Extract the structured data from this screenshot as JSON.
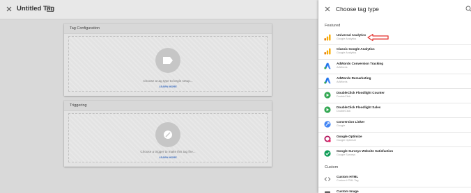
{
  "editor": {
    "title": "Untitled Tag",
    "tag_card": {
      "header": "Tag Configuration",
      "prompt": "Choose a tag type to begin setup...",
      "learn_more": "LEARN MORE"
    },
    "trigger_card": {
      "header": "Triggering",
      "prompt": "Choose a trigger to make this tag fire...",
      "learn_more": "LEARN MORE"
    }
  },
  "panel": {
    "title": "Choose tag type",
    "featured_label": "Featured",
    "custom_label": "Custom",
    "featured": [
      {
        "name": "Universal Analytics",
        "sub": "Google Analytics",
        "icon": "google-analytics-icon"
      },
      {
        "name": "Classic Google Analytics",
        "sub": "Google Analytics",
        "icon": "google-analytics-icon"
      },
      {
        "name": "AdWords Conversion Tracking",
        "sub": "AdWords",
        "icon": "adwords-icon"
      },
      {
        "name": "AdWords Remarketing",
        "sub": "AdWords",
        "icon": "adwords-icon"
      },
      {
        "name": "DoubleClick Floodlight Counter",
        "sub": "DoubleClick",
        "icon": "doubleclick-icon"
      },
      {
        "name": "DoubleClick Floodlight Sales",
        "sub": "DoubleClick",
        "icon": "doubleclick-icon"
      },
      {
        "name": "Conversion Linker",
        "sub": "Google",
        "icon": "conversion-linker-icon"
      },
      {
        "name": "Google Optimize",
        "sub": "Google Optimize",
        "icon": "google-optimize-icon"
      },
      {
        "name": "Google Surveys Website Satisfaction",
        "sub": "Google Surveys",
        "icon": "google-surveys-icon"
      }
    ],
    "custom": [
      {
        "name": "Custom HTML",
        "sub": "Custom HTML Tag",
        "icon": "code-icon"
      },
      {
        "name": "Custom Image",
        "sub": "",
        "icon": "image-icon"
      }
    ]
  },
  "colors": {
    "analytics_orange": "#f9ab00",
    "analytics_dark": "#e37400",
    "adwords_blue": "#4285f4",
    "doubleclick_green": "#34a853",
    "annotation_red": "#e53935",
    "link_blue": "#3f6fbf"
  }
}
